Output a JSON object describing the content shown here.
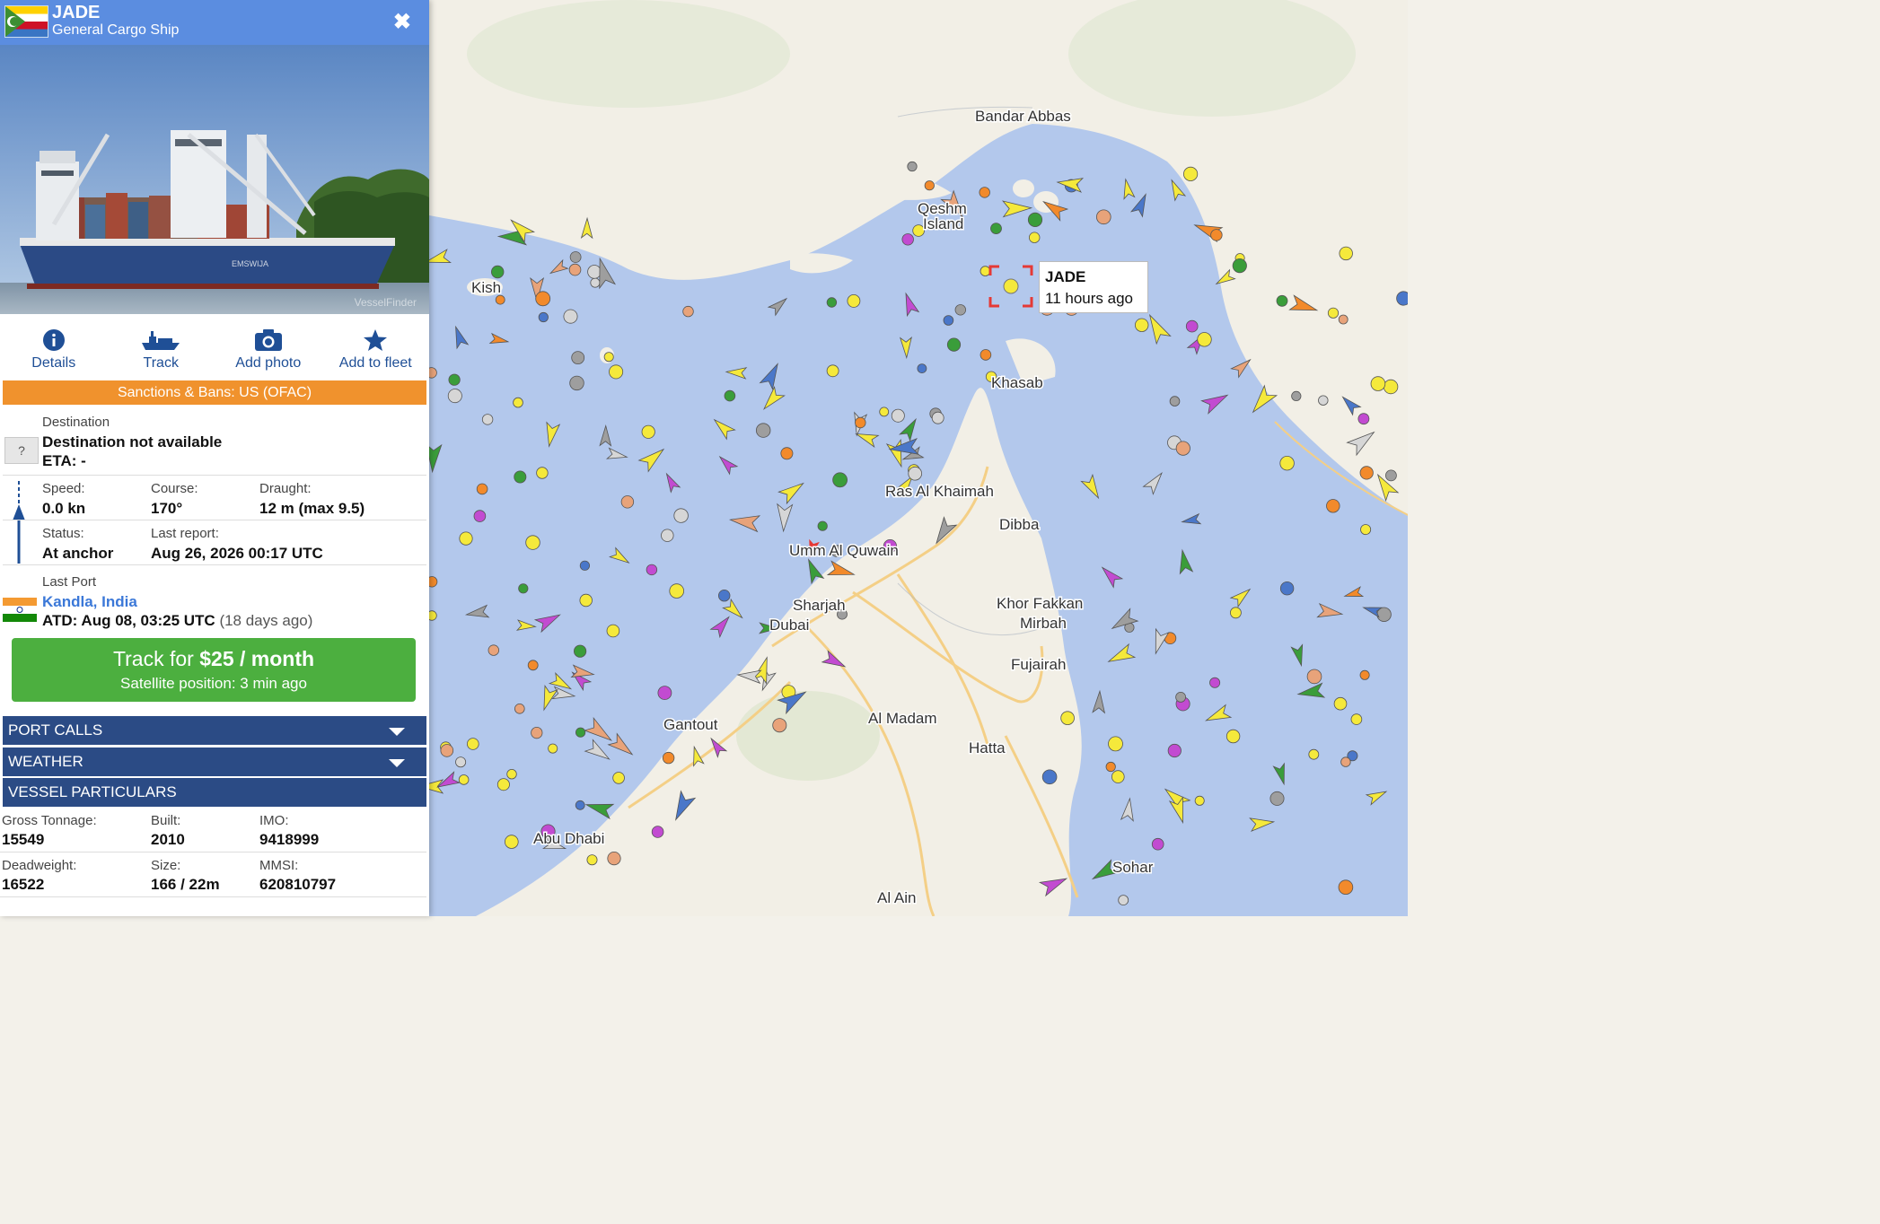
{
  "vessel": {
    "name": "JADE",
    "type": "General Cargo Ship",
    "photo_credit": "VesselFinder",
    "hull_name": "EMSWIJA"
  },
  "actions": [
    {
      "label": "Details",
      "icon": "info-icon"
    },
    {
      "label": "Track",
      "icon": "ship-icon"
    },
    {
      "label": "Add photo",
      "icon": "camera-icon"
    },
    {
      "label": "Add to fleet",
      "icon": "star-icon"
    }
  ],
  "sanctions": "Sanctions & Bans: US (OFAC)",
  "destination": {
    "label": "Destination",
    "value": "Destination not available",
    "eta": "ETA: -",
    "icon_text": "?"
  },
  "nav": {
    "speed_label": "Speed:",
    "speed": "0.0 kn",
    "course_label": "Course:",
    "course": "170°",
    "draught_label": "Draught:",
    "draught": "12 m (max 9.5)",
    "status_label": "Status:",
    "status": "At anchor",
    "report_label": "Last report:",
    "report": "Aug 26, 2026 00:17 UTC"
  },
  "last_port": {
    "label": "Last Port",
    "name": "Kandla, India",
    "atd": "ATD: Aug 08, 03:25 UTC",
    "ago": "(18 days ago)"
  },
  "track_button": {
    "prefix": "Track for ",
    "price": "$25 / month",
    "subtitle": "Satellite position: 3 min ago"
  },
  "sections": [
    {
      "label": "PORT CALLS"
    },
    {
      "label": "WEATHER"
    },
    {
      "label": "VESSEL PARTICULARS"
    }
  ],
  "particulars": {
    "gt_label": "Gross Tonnage:",
    "gt": "15549",
    "built_label": "Built:",
    "built": "2010",
    "imo_label": "IMO:",
    "imo": "9418999",
    "dwt_label": "Deadweight:",
    "dwt": "16522",
    "size_label": "Size:",
    "size": "166 / 22m",
    "mmsi_label": "MMSI:",
    "mmsi": "620810797"
  },
  "map": {
    "labels": [
      "Bandar Abbas",
      "Qeshm",
      "Island",
      "Kish",
      "Khasab",
      "Ras Al Khaimah",
      "Dibba",
      "Umm Al Quwain",
      "Sharjah",
      "Dubai",
      "Khor Fakkan",
      "Mirbah",
      "Fujairah",
      "Al Madam",
      "Hatta",
      "Gantout",
      "Abu Dhabi",
      "Sohar",
      "Al Ain"
    ],
    "tooltip_name": "JADE",
    "tooltip_time": "11 hours ago",
    "colors": {
      "sea": "#b3c8ec",
      "land": "#f2efe6",
      "road": "#f4cf86",
      "selected": "#e53935"
    }
  }
}
